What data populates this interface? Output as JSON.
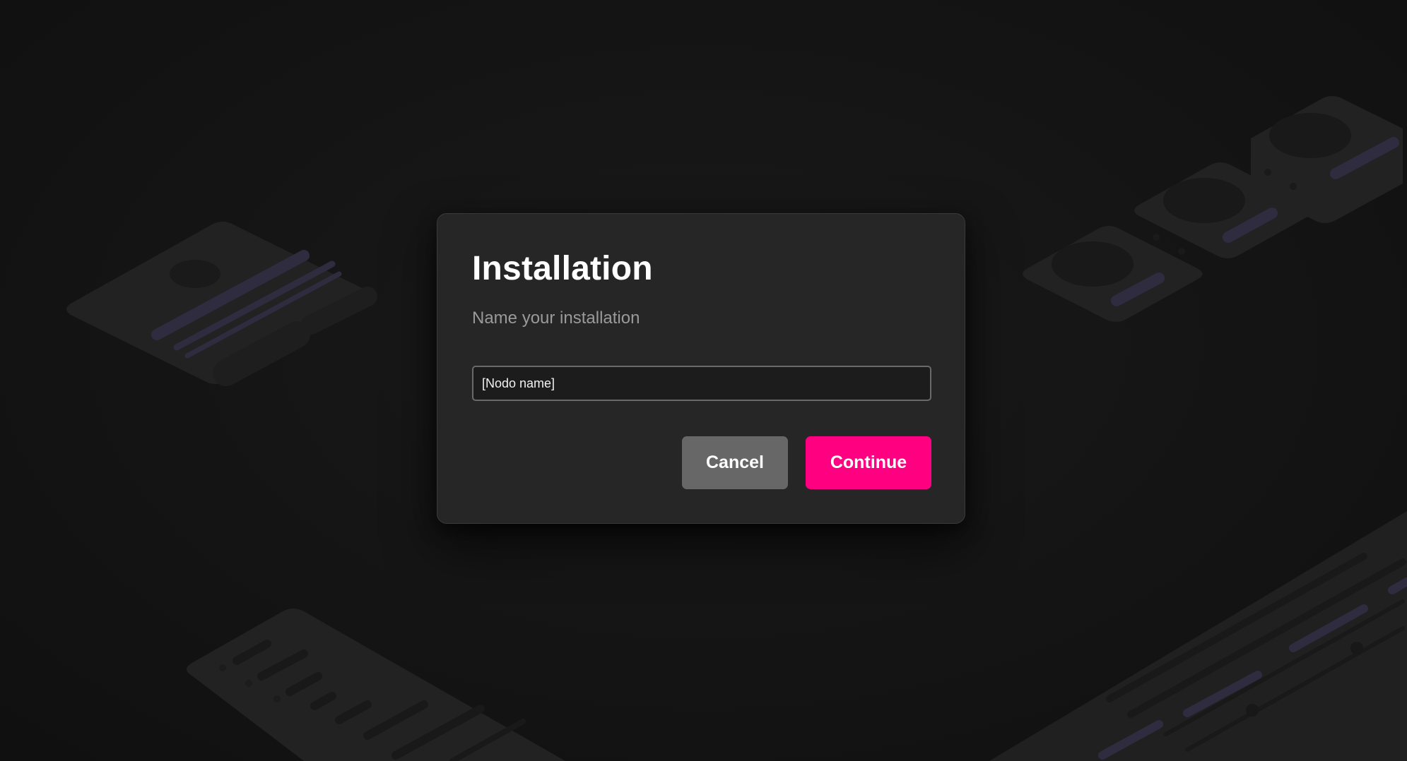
{
  "dialog": {
    "title": "Installation",
    "subtitle": "Name your installation",
    "input_value": "[Nodo name]",
    "cancel_label": "Cancel",
    "continue_label": "Continue"
  },
  "colors": {
    "background": "#121212",
    "dialog_surface": "#262626",
    "accent": "#ff0080",
    "secondary_button": "#676767",
    "decor_panel": "#252525",
    "decor_stripe": "#33304a"
  }
}
